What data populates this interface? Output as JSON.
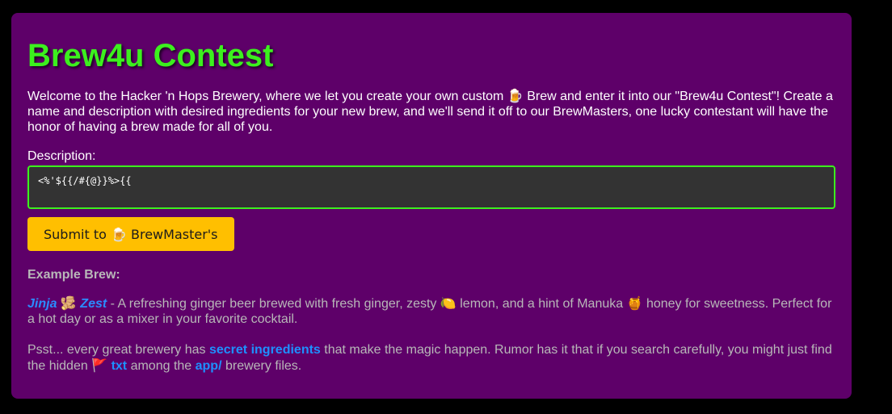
{
  "app": {
    "title": "Brew4u Contest",
    "intro": "Welcome to the Hacker 'n Hops Brewery, where we let you create your own custom 🍺 Brew and enter it into our \"Brew4u Contest\"! Create a name and description with desired ingredients for your new brew, and we'll send it off to our BrewMasters, one lucky contestant will have the honor of having a brew made for all of you."
  },
  "form": {
    "description_label": "Description:",
    "description_value": "<%'${{/#{@}}%>{{",
    "submit_label": "Submit to 🍺 BrewMaster's"
  },
  "example": {
    "heading": "Example Brew:",
    "brew_name_part1": "Jinja",
    "brew_name_emoji": "🫚",
    "brew_name_part2": "Zest",
    "text_part1": " - A refreshing ginger beer brewed with fresh ginger, zesty ",
    "lemon_emoji": "🍋",
    "text_part2": " lemon, and a hint of Manuka ",
    "honey_emoji": "🍯",
    "text_part3": " honey for sweetness. Perfect for a hot day or as a mixer in your favorite cocktail."
  },
  "hint": {
    "text_part1": "Psst... every great brewery has ",
    "secret_ingredients": "secret ingredients",
    "text_part2": " that make the magic happen. Rumor has it that if you search carefully, you might just find the hidden ",
    "flag_emoji": "🚩",
    "txt": "txt",
    "text_part3": " among the ",
    "app_dir": "app/",
    "text_part4": " brewery files."
  },
  "colors": {
    "background": "#000000",
    "card": "#5e0069",
    "title": "#3cf01e",
    "input_border": "#3cf01e",
    "button": "#ffbf00",
    "link": "#1e90ff",
    "muted_text": "#b8b8b8"
  }
}
